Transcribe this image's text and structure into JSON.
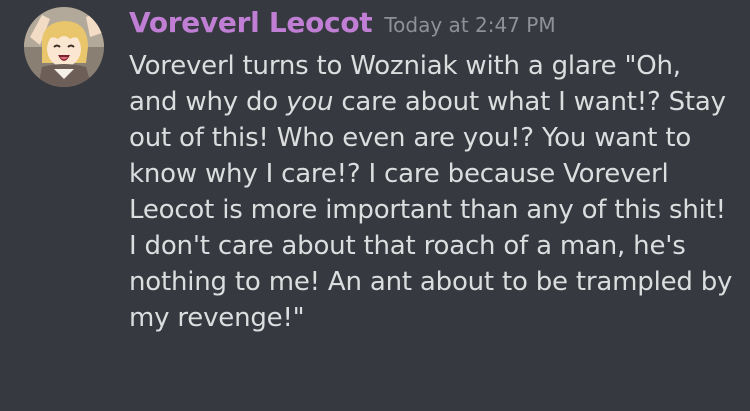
{
  "message": {
    "author": "Voreverl Leocot",
    "author_color": "#c07fd5",
    "timestamp": "Today at 2:47 PM",
    "avatar_icon": "anime-character-avatar",
    "content": {
      "part1": "Voreverl turns to Wozniak with a glare \"Oh, and why do ",
      "emphasis": "you",
      "part2": " care about what I want!? Stay out of this! Who even are you!? You want to know why I care!? I care because Voreverl Leocot is more important than any of this shit! I don't care about that roach of a man, he's nothing to me! An ant about to be trampled by my revenge!\""
    }
  }
}
